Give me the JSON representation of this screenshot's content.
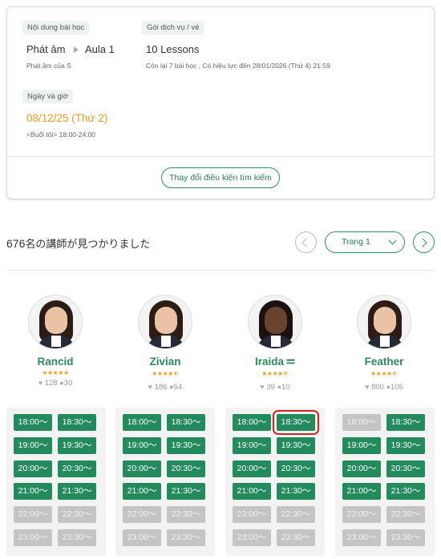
{
  "search_card": {
    "lesson_label": "Nội dung bài học",
    "lesson_main": "Phát âm",
    "lesson_sub": "Aula 1",
    "lesson_note": "Phát âm của S",
    "package_label": "Gói dịch vụ / vé",
    "package_name": "10 Lessons",
    "package_note": "Còn lại 7 bài học , Có hiệu lực đến 28/01/2026 (Thứ 4) 21:59",
    "date_label": "Ngày và giờ",
    "date_value": "08/12/25 (Thứ 2)",
    "time_range_label": "<Buổi tối>",
    "time_range": "18:00-24:00",
    "change_button": "Thay đổi điều kiện tìm kiếm"
  },
  "results": {
    "count": "676",
    "count_suffix": "名の講師が見つかりました",
    "page_label": "Trang 1"
  },
  "teachers": [
    {
      "name": "Rancid",
      "stars": "★★★★★",
      "likes": "128",
      "comments": "30",
      "slots": [
        {
          "time": "18:00〜",
          "available": true
        },
        {
          "time": "18:30〜",
          "available": true
        },
        {
          "time": "19:00〜",
          "available": true
        },
        {
          "time": "19:30〜",
          "available": true
        },
        {
          "time": "20:00〜",
          "available": true
        },
        {
          "time": "20:30〜",
          "available": true
        },
        {
          "time": "21:00〜",
          "available": true
        },
        {
          "time": "21:30〜",
          "available": true
        },
        {
          "time": "22:00〜",
          "available": false
        },
        {
          "time": "22:30〜",
          "available": false
        },
        {
          "time": "23:00〜",
          "available": false
        },
        {
          "time": "23:30〜",
          "available": false
        }
      ]
    },
    {
      "name": "Zivian",
      "stars": "★★★★⯪",
      "likes": "186",
      "comments": "54",
      "slots": [
        {
          "time": "18:00〜",
          "available": true
        },
        {
          "time": "18:30〜",
          "available": true
        },
        {
          "time": "19:00〜",
          "available": true
        },
        {
          "time": "19:30〜",
          "available": true
        },
        {
          "time": "20:00〜",
          "available": true
        },
        {
          "time": "20:30〜",
          "available": true
        },
        {
          "time": "21:00〜",
          "available": true
        },
        {
          "time": "21:30〜",
          "available": true
        },
        {
          "time": "22:00〜",
          "available": false
        },
        {
          "time": "22:30〜",
          "available": false
        },
        {
          "time": "23:00〜",
          "available": false
        },
        {
          "time": "23:30〜",
          "available": false
        }
      ]
    },
    {
      "name": "Iraida",
      "stars": "★★★★⯪",
      "likes": "39",
      "comments": "10",
      "slots": [
        {
          "time": "18:00〜",
          "available": true
        },
        {
          "time": "18:30〜",
          "available": true,
          "highlighted": true
        },
        {
          "time": "19:00〜",
          "available": true
        },
        {
          "time": "19:30〜",
          "available": true
        },
        {
          "time": "20:00〜",
          "available": true
        },
        {
          "time": "20:30〜",
          "available": true
        },
        {
          "time": "21:00〜",
          "available": true
        },
        {
          "time": "21:30〜",
          "available": true
        },
        {
          "time": "22:00〜",
          "available": false
        },
        {
          "time": "22:30〜",
          "available": false
        },
        {
          "time": "23:00〜",
          "available": false
        },
        {
          "time": "23:30〜",
          "available": false
        }
      ]
    },
    {
      "name": "Feather",
      "stars": "★★★★⯪",
      "likes": "800",
      "comments": "105",
      "slots": [
        {
          "time": "18:00〜",
          "available": false
        },
        {
          "time": "18:30〜",
          "available": true
        },
        {
          "time": "19:00〜",
          "available": true
        },
        {
          "time": "19:30〜",
          "available": true
        },
        {
          "time": "20:00〜",
          "available": true
        },
        {
          "time": "20:30〜",
          "available": true
        },
        {
          "time": "21:00〜",
          "available": true
        },
        {
          "time": "21:30〜",
          "available": true
        },
        {
          "time": "22:00〜",
          "available": false
        },
        {
          "time": "22:30〜",
          "available": false
        },
        {
          "time": "23:00〜",
          "available": false
        },
        {
          "time": "23:30〜",
          "available": false
        }
      ]
    }
  ],
  "icons": {
    "like": "heart-icon",
    "comment": "comment-icon",
    "prev": "chevron-left-icon",
    "next": "chevron-right-icon",
    "dropdown": "chevron-down-icon"
  },
  "colors": {
    "accent": "#238a5e",
    "date": "#f09a18",
    "stars": "#f0a020",
    "unavailable": "#c4c4c4",
    "highlight": "#d42323"
  }
}
